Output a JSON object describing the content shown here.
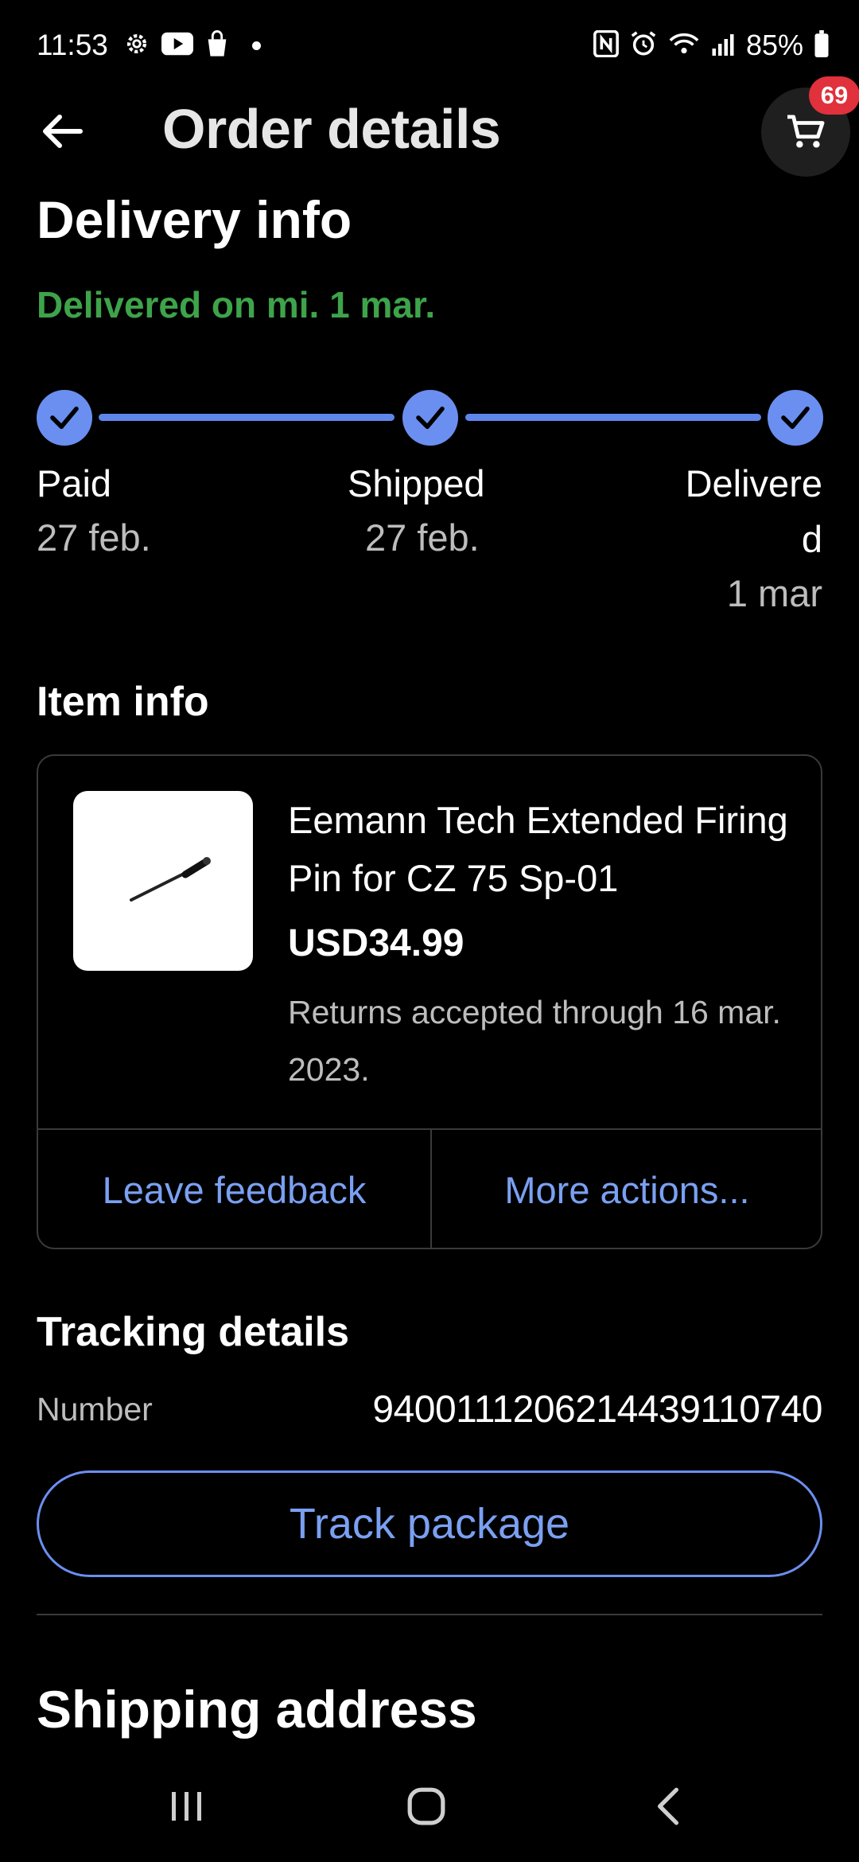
{
  "status_bar": {
    "time": "11:53",
    "battery_percent": "85%",
    "left_icons": [
      "gear-icon",
      "youtube-icon",
      "shopping-bag-icon",
      "notification-dot"
    ],
    "right_icons": [
      "nfc-icon",
      "alarm-icon",
      "wifi-icon",
      "signal-icon",
      "battery-icon"
    ]
  },
  "header": {
    "title": "Order details",
    "cart_badge_count": "69"
  },
  "delivery": {
    "section_title": "Delivery info",
    "status_text": "Delivered on mi. 1 mar.",
    "steps": [
      {
        "label": "Paid",
        "date": "27 feb."
      },
      {
        "label": "Shipped",
        "date": "27 feb."
      },
      {
        "label_line1": "Delivere",
        "label_line2": "d",
        "date": "1 mar"
      }
    ]
  },
  "item": {
    "section_title": "Item info",
    "title": "Eemann Tech Extended Firing Pin for CZ 75 Sp-01",
    "price": "USD34.99",
    "returns_text": "Returns accepted through 16 mar. 2023.",
    "actions": {
      "leave_feedback": "Leave feedback",
      "more_actions": "More actions..."
    }
  },
  "tracking": {
    "section_title": "Tracking details",
    "number_label": "Number",
    "number_value": "9400111206214439110740",
    "track_button": "Track package"
  },
  "shipping": {
    "section_title": "Shipping address"
  },
  "colors": {
    "background": "#000000",
    "accent_blue": "#6b8ff0",
    "link_blue": "#7aa0f2",
    "success_green": "#3ea34a",
    "badge_red": "#e0313c",
    "muted_text": "#bdbdbd",
    "border": "#3a3a3a"
  }
}
